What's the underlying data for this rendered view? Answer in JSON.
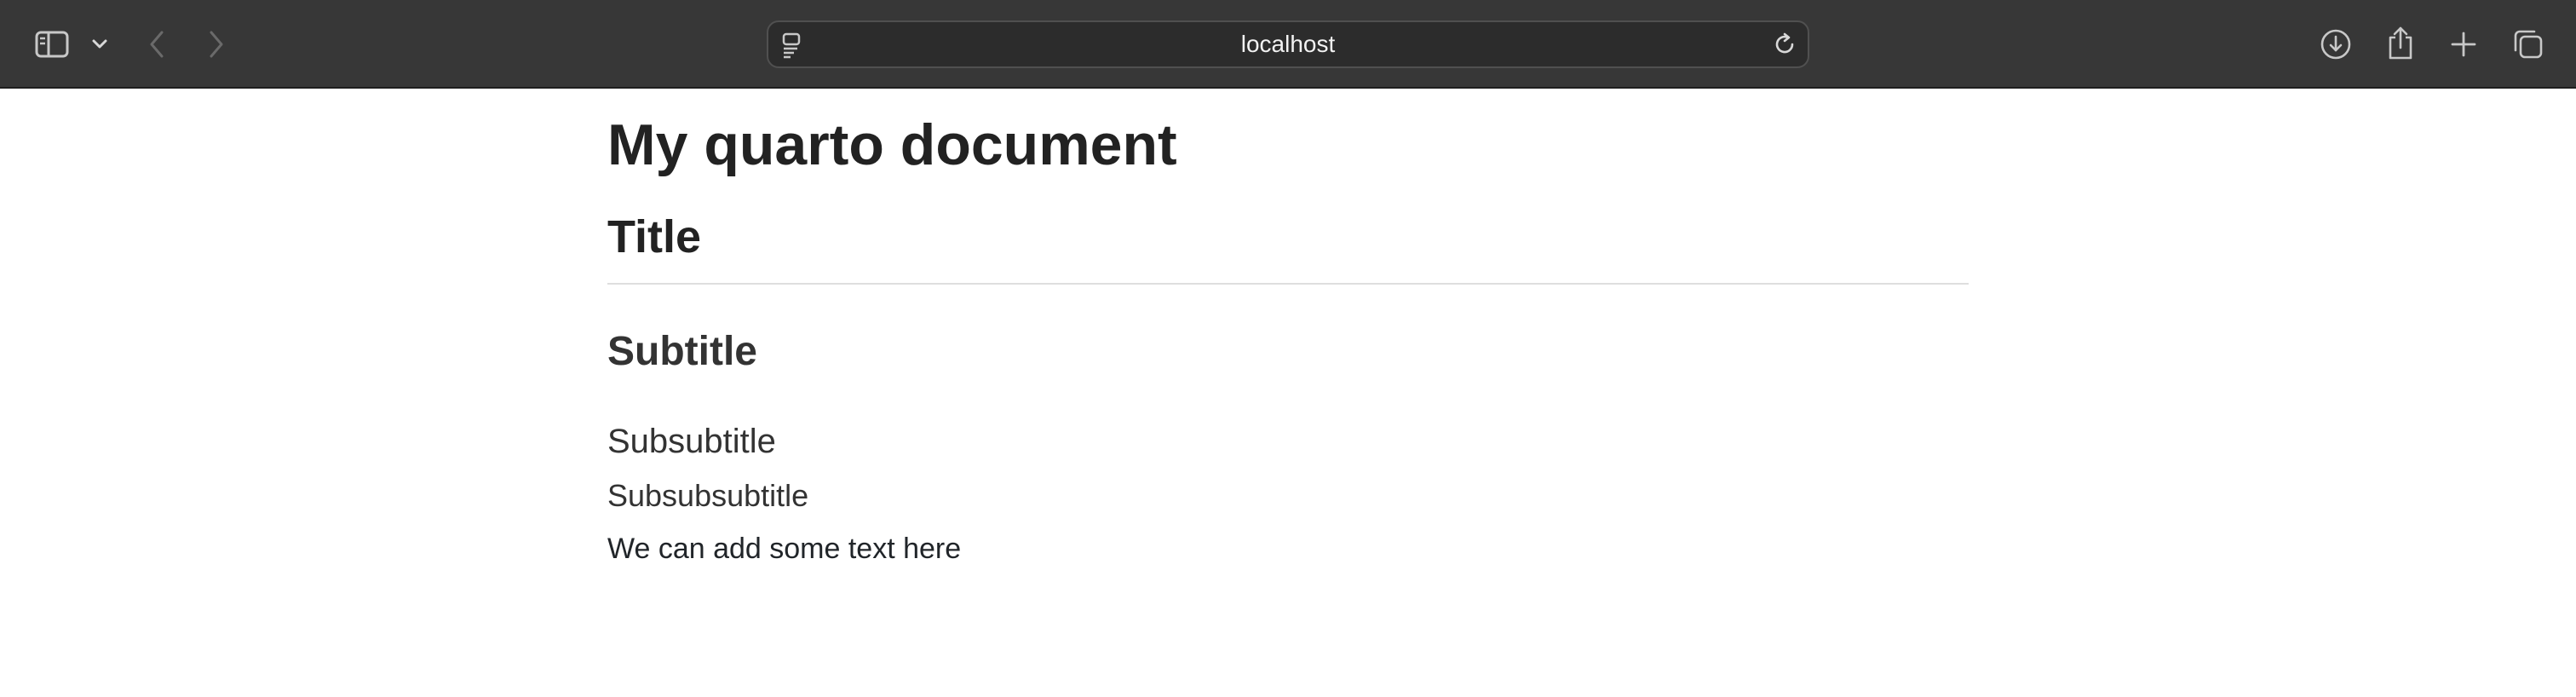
{
  "browser": {
    "address_bar": {
      "url": "localhost"
    },
    "toolbar_icons": {
      "sidebar": "sidebar-icon",
      "chevron": "chevron-down-icon",
      "back": "back-arrow-icon",
      "forward": "forward-arrow-icon",
      "page_menu": "page-menu-icon",
      "reload": "reload-icon",
      "downloads": "download-icon",
      "share": "share-icon",
      "new_tab": "plus-icon",
      "tab_overview": "tabs-overview-icon"
    },
    "colors": {
      "toolbar_bg": "#373737",
      "address_bg": "#2c2c2c",
      "icon": "#c8c8c8",
      "icon_disabled": "#6a6a6a"
    }
  },
  "document": {
    "title": "My quarto document",
    "h1": "Title",
    "h2": "Subtitle",
    "h3": "Subsubtitle",
    "h4": "Subsubsubtitle",
    "paragraph": "We can add some text here"
  }
}
